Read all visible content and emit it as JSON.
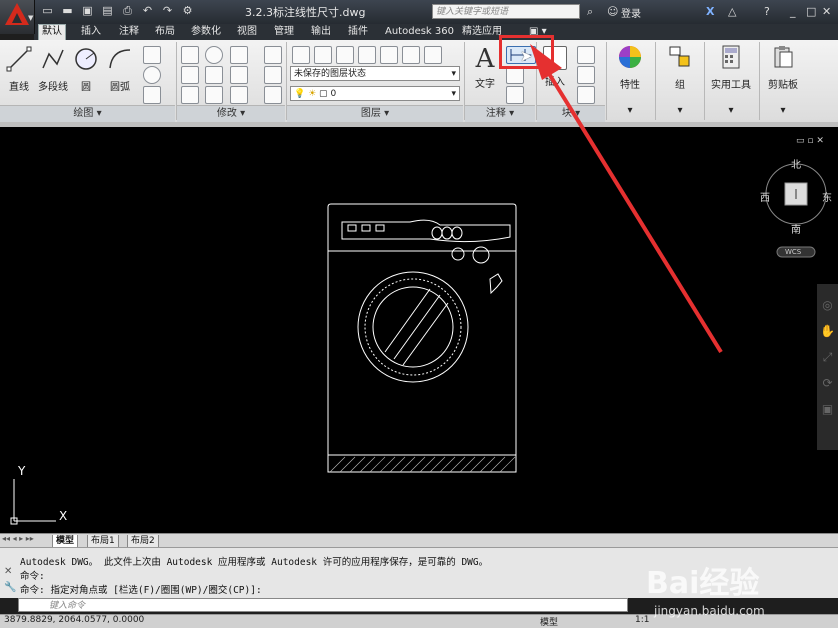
{
  "title_bar": {
    "document_title": "3.2.3标注线性尺寸.dwg",
    "search_placeholder": "键入关键字或短语",
    "login_label": "登录"
  },
  "ribbon_tabs": [
    "默认",
    "插入",
    "注释",
    "布局",
    "参数化",
    "视图",
    "管理",
    "输出",
    "插件",
    "Autodesk 360",
    "精选应用"
  ],
  "ribbon": {
    "draw": {
      "title": "绘图",
      "line": "直线",
      "polyline": "多段线",
      "circle": "圆",
      "arc": "圆弧"
    },
    "modify": {
      "title": "修改"
    },
    "layers": {
      "title": "图层",
      "layer_state": "未保存的图层状态",
      "layer_value": "0"
    },
    "annotation": {
      "title": "注释",
      "text": "文字"
    },
    "block": {
      "insert": "插入",
      "title": "块"
    },
    "properties": {
      "label": "特性"
    },
    "groups": {
      "label": "组"
    },
    "utilities": {
      "label": "实用工具"
    },
    "clipboard": {
      "label": "剪贴板"
    }
  },
  "viewcube": {
    "north": "北",
    "south": "南",
    "east": "东",
    "west": "西",
    "wcs": "WCS"
  },
  "ucs": {
    "x": "X",
    "y": "Y"
  },
  "layout_tabs": [
    "模型",
    "布局1",
    "布局2"
  ],
  "command_history": [
    "Autodesk DWG。  此文件上次由 Autodesk 应用程序或 Autodesk 许可的应用程序保存，是可靠的 DWG。",
    "命令:",
    "命令: 指定对角点或 [栏选(F)/圈围(WP)/圈交(CP)]:"
  ],
  "command_placeholder": "键入命令",
  "status": {
    "coordinates": "3879.8829, 2064.0577, 0.0000",
    "model": "模型",
    "scale": "1:1"
  },
  "watermark": {
    "brand": "Bai经验",
    "url": "jingyan.baidu.com"
  },
  "colors": {
    "highlight": "#e53030",
    "canvas": "#000000",
    "autocad_red": "#d42a1c"
  }
}
